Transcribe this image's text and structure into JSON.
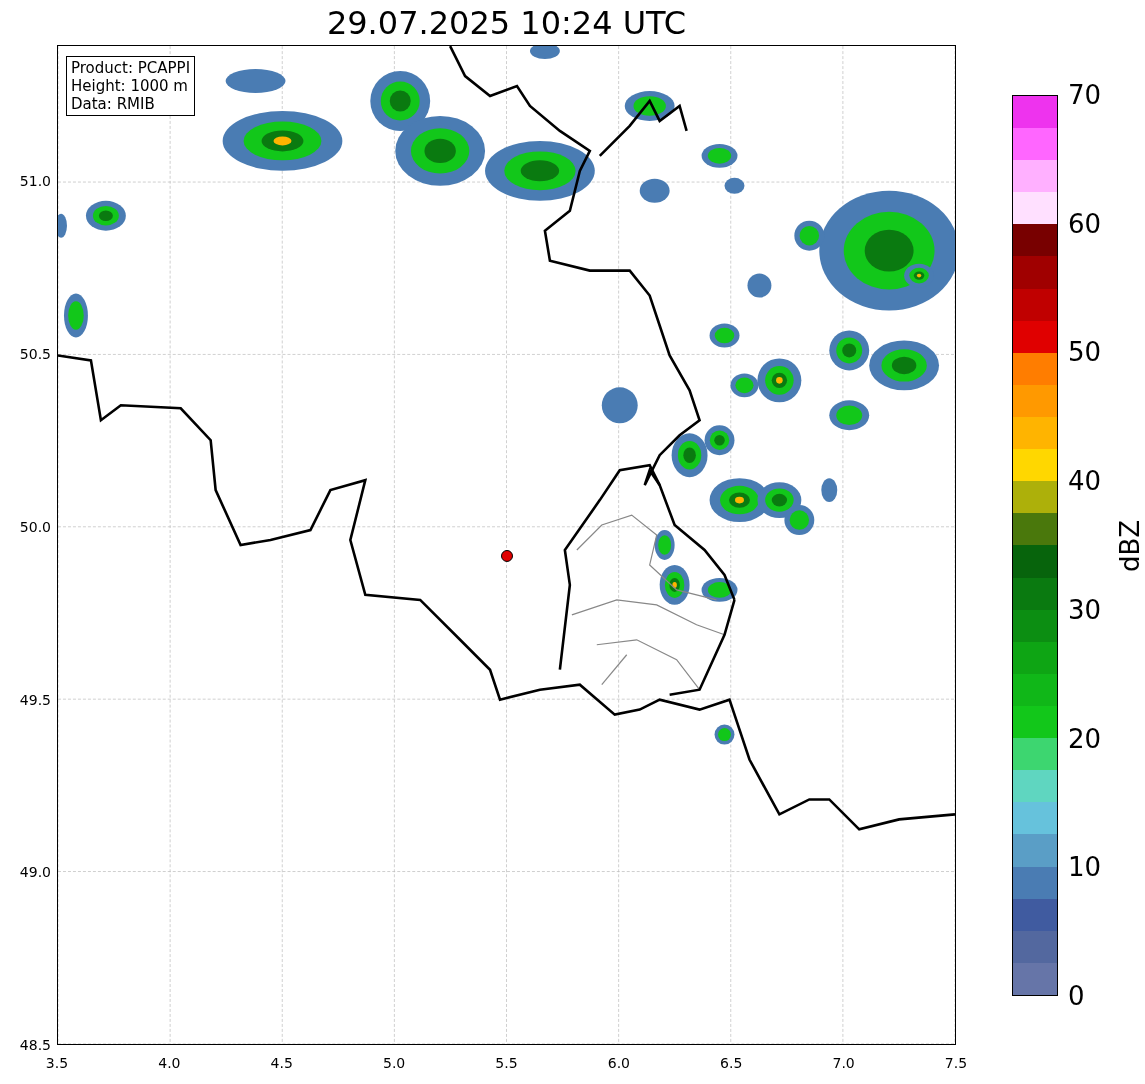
{
  "title": "29.07.2025 10:24 UTC",
  "map": {
    "info_box": [
      "Product: PCAPPI",
      "Height: 1000 m",
      "Data: RMIB"
    ],
    "x_ticks": [
      "3.5",
      "4.0",
      "4.5",
      "5.0",
      "5.5",
      "6.0",
      "6.5",
      "7.0",
      "7.5"
    ],
    "y_ticks": [
      "51.0",
      "50.5",
      "50.0",
      "49.5",
      "49.0",
      "48.5"
    ]
  },
  "colorbar": {
    "label": "dBZ",
    "ticks": [
      "70",
      "60",
      "50",
      "40",
      "30",
      "20",
      "10",
      "0"
    ],
    "bands": [
      {
        "color": "#6675a8"
      },
      {
        "color": "#53689f"
      },
      {
        "color": "#405ba0"
      },
      {
        "color": "#4a7cb3"
      },
      {
        "color": "#5a9ec6"
      },
      {
        "color": "#66c2dc"
      },
      {
        "color": "#5fd6c0"
      },
      {
        "color": "#3dd670"
      },
      {
        "color": "#12c71a"
      },
      {
        "color": "#10b718"
      },
      {
        "color": "#0ea514"
      },
      {
        "color": "#0c8e12"
      },
      {
        "color": "#0a7a10"
      },
      {
        "color": "#07640c"
      },
      {
        "color": "#4a780c"
      },
      {
        "color": "#adb00a"
      },
      {
        "color": "#ffd700"
      },
      {
        "color": "#ffb400"
      },
      {
        "color": "#ff9900"
      },
      {
        "color": "#ff7d00"
      },
      {
        "color": "#e00000"
      },
      {
        "color": "#c00000"
      },
      {
        "color": "#a00000"
      },
      {
        "color": "#780000"
      },
      {
        "color": "#ffe0ff"
      },
      {
        "color": "#ffb0ff"
      },
      {
        "color": "#ff66ff"
      },
      {
        "color": "#ee33ee"
      }
    ]
  }
}
